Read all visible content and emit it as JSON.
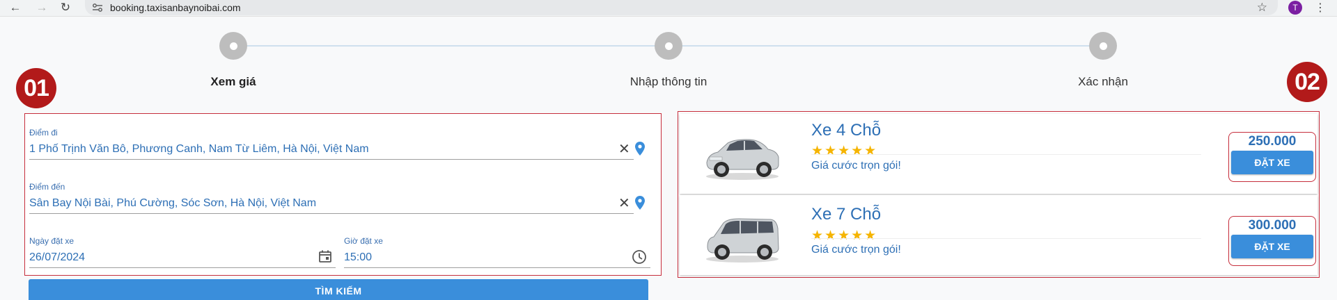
{
  "browser": {
    "url": "booking.taxisanbaynoibai.com",
    "profile_initial": "T",
    "back_icon": "←",
    "forward_icon": "→",
    "reload_icon": "↻",
    "star_icon": "☆",
    "menu_icon": "⋮"
  },
  "stepper": {
    "steps": [
      {
        "label": "Xem giá",
        "active": true
      },
      {
        "label": "Nhập thông tin",
        "active": false
      },
      {
        "label": "Xác nhận",
        "active": false
      }
    ]
  },
  "badges": {
    "left": "01",
    "right": "02"
  },
  "form": {
    "origin_label": "Điểm đi",
    "origin_value": "1 Phố Trịnh Văn Bô, Phương Canh, Nam Từ Liêm, Hà Nội, Việt Nam",
    "destination_label": "Điểm đến",
    "destination_value": "Sân Bay Nội Bài, Phú Cường, Sóc Sơn, Hà Nội, Việt Nam",
    "date_label": "Ngày đặt xe",
    "date_value": "26/07/2024",
    "time_label": "Giờ đặt xe",
    "time_value": "15:00",
    "clear_icon": "✕",
    "search_button": "TÌM KIẾM"
  },
  "vehicles": [
    {
      "name": "Xe 4 Chỗ",
      "stars": "★★★★★",
      "rating": 5,
      "description": "Giá cước trọn gói!",
      "price": "250.000",
      "button": "ĐẶT XE"
    },
    {
      "name": "Xe 7 Chỗ",
      "stars": "★★★★★",
      "rating": 5,
      "description": "Giá cước trọn gói!",
      "price": "300.000",
      "button": "ĐẶT XE"
    }
  ],
  "colors": {
    "accent": "#3a8edb",
    "text_blue": "#2d6fb5",
    "badge_red": "#b21a1a",
    "highlight_border": "#c62d3b",
    "star": "#f5b400"
  }
}
